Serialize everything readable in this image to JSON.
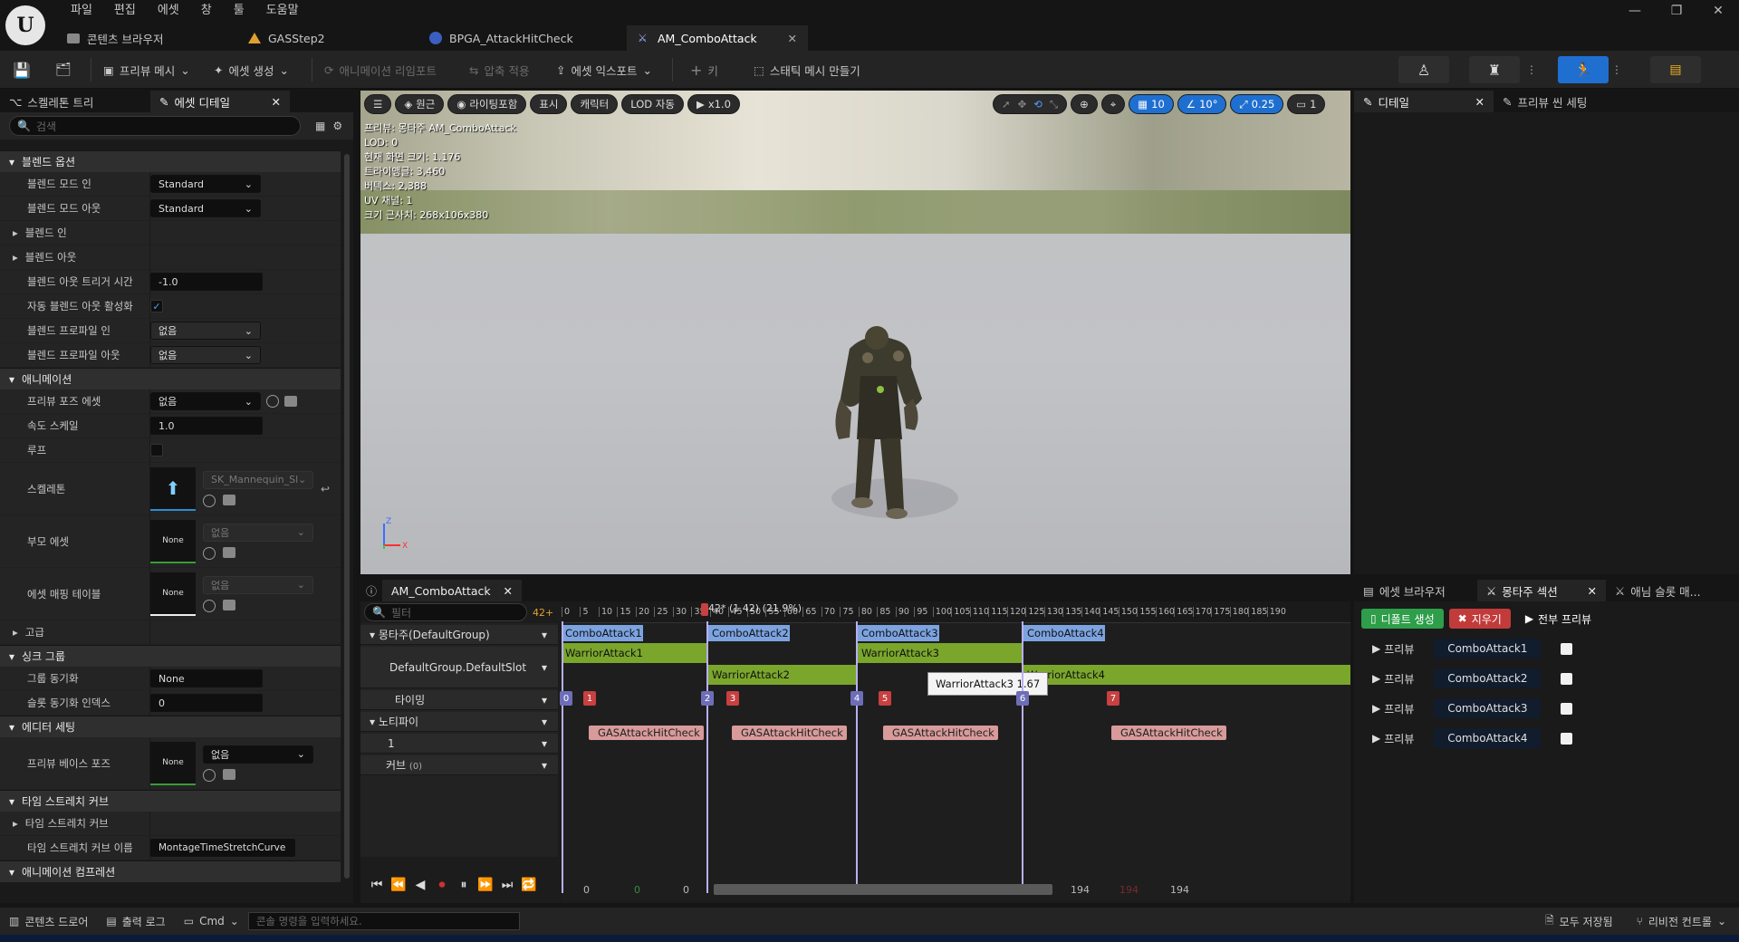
{
  "menu": [
    "파일",
    "편집",
    "에셋",
    "창",
    "툴",
    "도움말"
  ],
  "tabs": [
    {
      "label": "콘텐츠 브라우저"
    },
    {
      "label": "GASStep2"
    },
    {
      "label": "BPGA_AttackHitCheck"
    },
    {
      "label": "AM_ComboAttack",
      "active": true
    }
  ],
  "toolbar": {
    "preview_mesh": "프리뷰 메시",
    "create_asset": "에셋 생성",
    "reimport": "애니메이션 리임포트",
    "apply_compression": "압축 적용",
    "export_asset": "에셋 익스포트",
    "key": "키",
    "make_static_mesh": "스태틱 메시 만들기"
  },
  "left_panel": {
    "tab_skeleton_tree": "스켈레톤 트리",
    "tab_asset_details": "에셋 디테일",
    "search_placeholder": "검색",
    "sections": {
      "blend_options": "블렌드 옵션",
      "animation": "애니메이션",
      "advanced": "고급",
      "sync_group": "싱크 그룹",
      "editor_settings": "에디터 세팅",
      "time_stretch_curve": "타임 스트레치 커브",
      "animation_compression": "애니메이션 컴프레션"
    },
    "props": {
      "blend_mode_in": "블렌드 모드 인",
      "blend_mode_in_val": "Standard",
      "blend_mode_out": "블렌드 모드 아웃",
      "blend_mode_out_val": "Standard",
      "blend_in": "블렌드 인",
      "blend_out": "블렌드 아웃",
      "blend_out_trigger_time": "블렌드 아웃 트리거 시간",
      "blend_out_trigger_time_val": "-1.0",
      "auto_blend_out": "자동 블렌드 아웃 활성화",
      "blend_profile_in": "블렌드 프로파일 인",
      "blend_profile_in_val": "없음",
      "blend_profile_out": "블렌드 프로파일 아웃",
      "blend_profile_out_val": "없음",
      "preview_pose_asset": "프리뷰 포즈 에셋",
      "preview_pose_asset_val": "없음",
      "rate_scale": "속도 스케일",
      "rate_scale_val": "1.0",
      "loop": "루프",
      "skeleton": "스켈레톤",
      "skeleton_val": "SK_Mannequin_Sl",
      "parent_asset": "부모 에셋",
      "parent_asset_val": "없음",
      "asset_mapping_table": "에셋 매핑 테이블",
      "asset_mapping_table_val": "없음",
      "group_sync": "그룹 동기화",
      "group_sync_val": "None",
      "slot_sync_index": "슬롯 동기화 인덱스",
      "slot_sync_index_val": "0",
      "preview_base_pose": "프리뷰 베이스 포즈",
      "preview_base_pose_val": "없음",
      "time_stretch_curve": "타임 스트레치 커브",
      "time_stretch_curve_name": "타임 스트레치 커브 이름",
      "time_stretch_curve_name_val": "MontageTimeStretchCurve",
      "thumb_none": "None"
    }
  },
  "viewport": {
    "pills": [
      "원근",
      "라이팅포함",
      "표시",
      "캐릭터",
      "LOD 자동",
      "x1.0"
    ],
    "right_pills": [
      "10",
      "10°",
      "0.25",
      "1"
    ],
    "stats": [
      "프리뷰: 몽타주 AM_ComboAttack",
      "LOD: 0",
      "현재 화면 크기: 1.176",
      "트라이앵글: 3,460",
      "버텍스: 2,388",
      "UV 채널: 1",
      "크기 근사치: 268x106x380"
    ]
  },
  "detail_panel": {
    "tab_details": "디테일",
    "tab_preview_scene": "프리뷰 씬 세팅"
  },
  "montage_panel": {
    "tab_asset_browser": "에셋 브라우저",
    "tab_montage_sections": "몽타주 섹션",
    "tab_anim_slot": "애님 슬롯 매...",
    "create_default": "디폴트 생성",
    "clear": "지우기",
    "preview_all": "전부 프리뷰",
    "preview_label": "프리뷰",
    "sections": [
      "ComboAttack1",
      "ComboAttack2",
      "ComboAttack3",
      "ComboAttack4"
    ]
  },
  "timeline": {
    "tab": "AM_ComboAttack",
    "filter_placeholder": "필터",
    "frame_count": "42+",
    "playhead": "42* (1.42) (21.9%)",
    "tracks": {
      "montage": "몽타주(DefaultGroup)",
      "slot": "DefaultGroup.DefaultSlot",
      "timing": "타이밍",
      "notify": "노티파이",
      "notify_track": "1",
      "curve": "커브",
      "curve_count": "(0)"
    },
    "ruler": [
      "0",
      "5",
      "10",
      "15",
      "20",
      "25",
      "30",
      "35",
      "40",
      "45",
      "50",
      "55",
      "60",
      "65",
      "70",
      "75",
      "80",
      "85",
      "90",
      "95",
      "100",
      "105",
      "110",
      "115",
      "120",
      "125",
      "130",
      "135",
      "140",
      "145",
      "150",
      "155",
      "160",
      "165",
      "170",
      "175",
      "180",
      "185",
      "190"
    ],
    "sections": [
      "ComboAttack1",
      "ComboAttack2",
      "ComboAttack3",
      "ComboAttack4"
    ],
    "anims": [
      "WarriorAttack1",
      "WarriorAttack2",
      "WarriorAttack3",
      "WarriorAttack4"
    ],
    "tooltip": "WarriorAttack3 1.67",
    "timing_markers": [
      "0",
      "1",
      "2",
      "3",
      "4",
      "5",
      "6",
      "7"
    ],
    "notifies": [
      "GASAttackHitCheck",
      "GASAttackHitCheck",
      "GASAttackHitCheck",
      "GASAttackHitCheck"
    ],
    "range_start": "0",
    "range_start2": "0",
    "range_start3": "0",
    "range_end": "194",
    "range_end2": "194",
    "range_end3": "194"
  },
  "statusbar": {
    "content_drawer": "콘텐츠 드로어",
    "output_log": "출력 로그",
    "cmd": "Cmd",
    "console_placeholder": "콘솔 명령을 입력하세요.",
    "save_all": "모두 저장됨",
    "revision_control": "리비전 컨트롤"
  },
  "colors": {
    "accent_blue": "#1f6fd1",
    "section_blue": "#7ca3e0",
    "anim_green": "#7aa62c",
    "notify_pink": "#d89a9a",
    "timing_red": "#c84040",
    "create_green": "#2e9e4a",
    "clear_red": "#c23b3b"
  }
}
